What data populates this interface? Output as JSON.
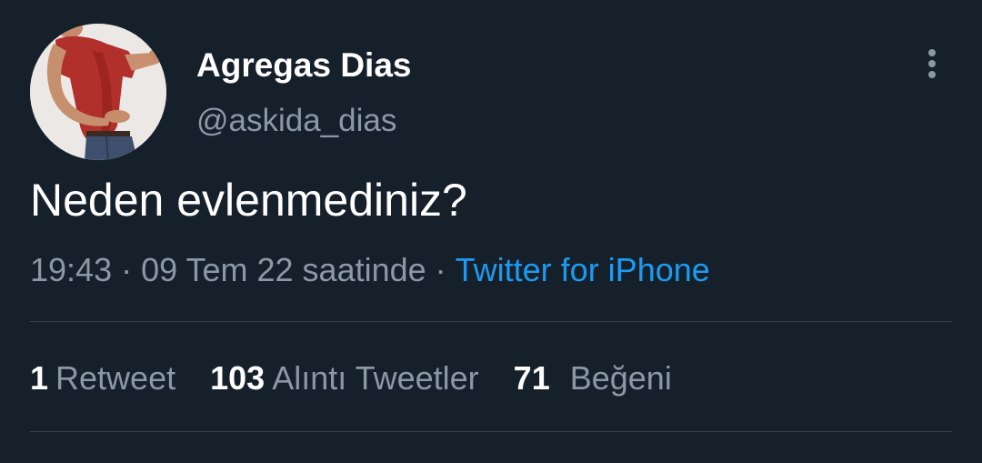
{
  "tweet": {
    "author": {
      "display_name": "Agregas Dias",
      "handle": "@askida_dias"
    },
    "text": "Neden evlenmediniz?",
    "time": "19:43",
    "date": "09 Tem 22 saatinde",
    "separator": "·",
    "source": "Twitter for iPhone",
    "stats": {
      "retweets": {
        "count": "1",
        "label": "Retweet"
      },
      "quotes": {
        "count": "103",
        "label": "Alıntı Tweetler"
      },
      "likes": {
        "count": "71",
        "label": "Beğeni"
      }
    },
    "icons": {
      "more": "more-vertical-icon"
    }
  },
  "theme": {
    "background": "#15202b",
    "text_primary": "#ffffff",
    "text_secondary": "#8b98a5",
    "link": "#1d9bf0",
    "divider": "#38444d"
  }
}
